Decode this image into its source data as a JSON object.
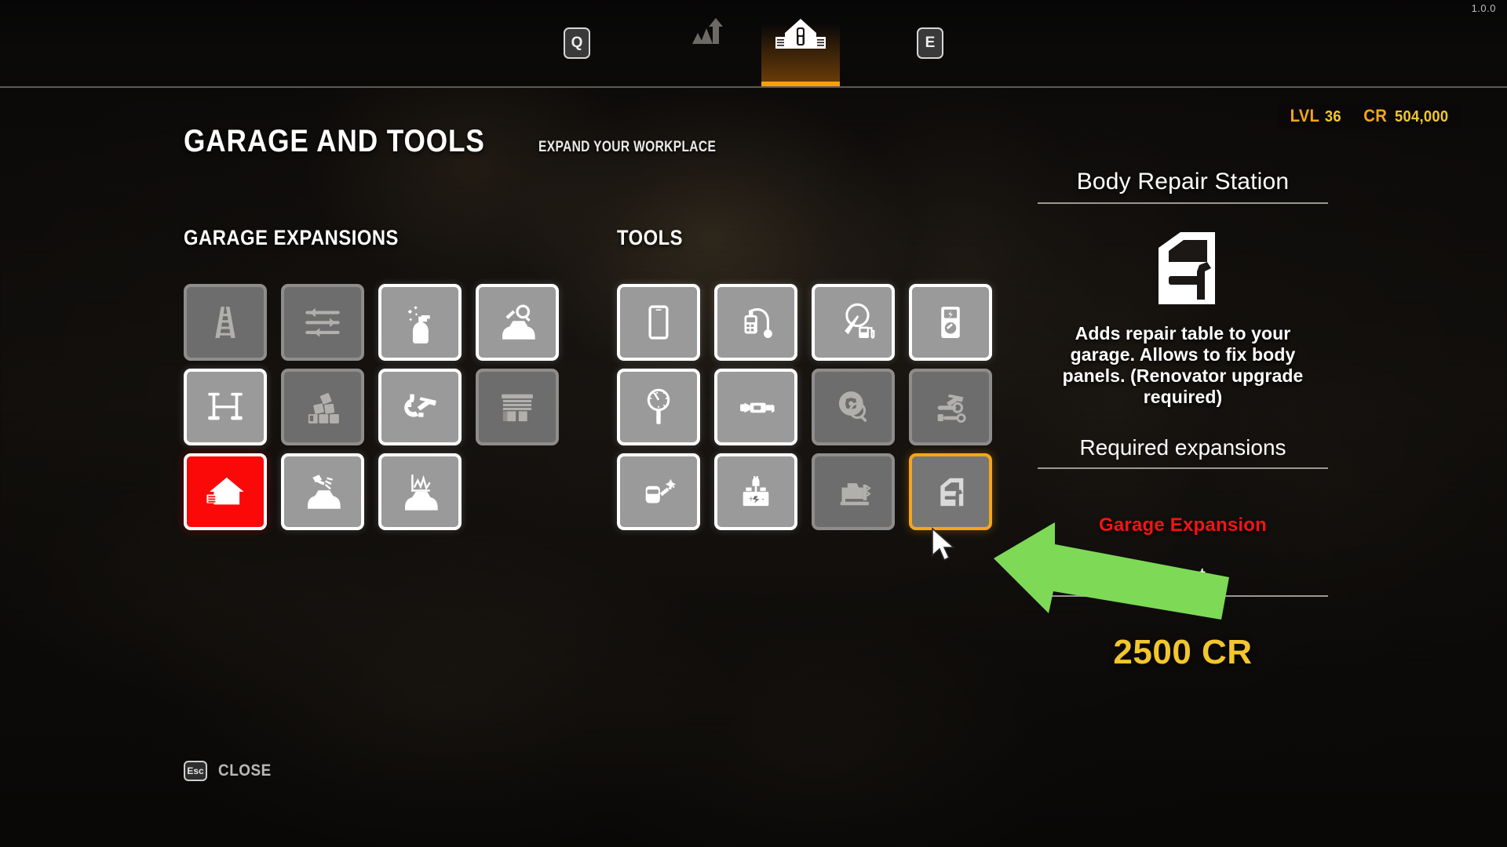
{
  "app": {
    "version": "1.0.0"
  },
  "nav": {
    "left_key": "Q",
    "right_key": "E",
    "tabs": [
      {
        "name": "skills-tab",
        "icon": "upgrade-chart-icon",
        "active": false
      },
      {
        "name": "garage-tab",
        "icon": "garage-building-icon",
        "active": true
      }
    ]
  },
  "header": {
    "title": "GARAGE AND TOOLS",
    "subtitle": "EXPAND YOUR WORKPLACE"
  },
  "hud": {
    "level_key": "LVL",
    "level_value": "36",
    "credits_key": "CR",
    "credits_value": "504,000",
    "accent_color": "#f7a51b"
  },
  "sections": {
    "garage": {
      "heading": "GARAGE EXPANSIONS",
      "tiles": [
        {
          "name": "tile-ladder",
          "icon": "ladder-icon",
          "state": "locked"
        },
        {
          "name": "tile-tuning-sliders",
          "icon": "sliders-icon",
          "state": "locked"
        },
        {
          "name": "tile-spray-bottle",
          "icon": "spray-bottle-icon",
          "state": "owned"
        },
        {
          "name": "tile-car-inspection",
          "icon": "car-inspection-icon",
          "state": "owned"
        },
        {
          "name": "tile-car-lift",
          "icon": "car-lift-icon",
          "state": "owned"
        },
        {
          "name": "tile-brick-wall",
          "icon": "brick-wall-icon",
          "state": "locked"
        },
        {
          "name": "tile-hammer-gear",
          "icon": "hammer-gear-icon",
          "state": "owned"
        },
        {
          "name": "tile-garage-door",
          "icon": "garage-door-icon",
          "state": "locked"
        },
        {
          "name": "tile-garage-expansion",
          "icon": "garage-house-icon",
          "state": "required"
        },
        {
          "name": "tile-paint-booth",
          "icon": "paint-spray-car-icon",
          "state": "owned"
        },
        {
          "name": "tile-dyno-station",
          "icon": "dyno-car-icon",
          "state": "owned"
        }
      ]
    },
    "tools": {
      "heading": "TOOLS",
      "tiles": [
        {
          "name": "tile-tablet",
          "icon": "tablet-icon",
          "state": "owned"
        },
        {
          "name": "tile-obd-scanner",
          "icon": "obd-scanner-icon",
          "state": "owned"
        },
        {
          "name": "tile-fuel-tester",
          "icon": "fuel-gauge-icon",
          "state": "owned"
        },
        {
          "name": "tile-multimeter",
          "icon": "multimeter-icon",
          "state": "owned"
        },
        {
          "name": "tile-compression-tester",
          "icon": "compression-gauge-icon",
          "state": "owned"
        },
        {
          "name": "tile-impact-wrench",
          "icon": "impact-wrench-icon",
          "state": "owned"
        },
        {
          "name": "tile-brake-inspector",
          "icon": "brake-disc-magnifier-icon",
          "state": "locked"
        },
        {
          "name": "tile-hammer-bench",
          "icon": "hammer-tools-icon",
          "state": "locked"
        },
        {
          "name": "tile-welder",
          "icon": "welder-icon",
          "state": "owned"
        },
        {
          "name": "tile-battery-charger",
          "icon": "battery-charger-icon",
          "state": "owned"
        },
        {
          "name": "tile-engine-stand",
          "icon": "engine-stand-icon",
          "state": "locked"
        },
        {
          "name": "tile-body-repair-station",
          "icon": "car-door-hammer-icon",
          "state": "selected"
        }
      ]
    }
  },
  "detail": {
    "title": "Body Repair Station",
    "icon": "car-door-hammer-icon",
    "description": "Adds repair table to your garage. Allows to fix body panels. (Renovator upgrade required)",
    "required_heading": "Required expansions",
    "required_items": [
      "Garage Expansion"
    ],
    "required_color": "#f41414",
    "cost_heading": "Cost",
    "cost_amount": "2500",
    "cost_unit": "CR",
    "cost_color": "#f2c62c"
  },
  "footer": {
    "key": "Esc",
    "label": "CLOSE"
  },
  "annotation": {
    "arrow_color": "#7ed957",
    "points_to": "tile-body-repair-station"
  }
}
